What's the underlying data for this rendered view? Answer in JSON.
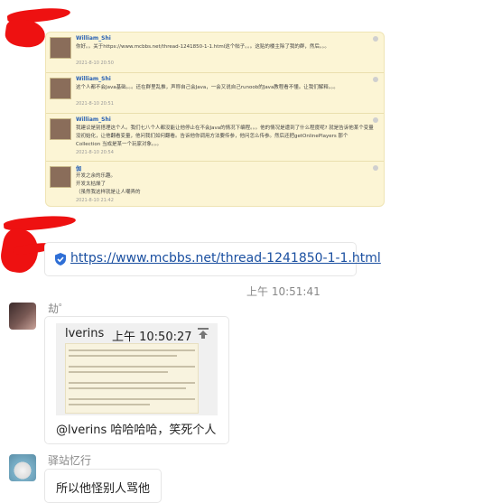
{
  "forum": {
    "posts": [
      {
        "author": "William_Shi",
        "text": "你好。。关于https://www.mcbbs.net/thread-1241850-1-1.html这个帖子。。。这贴的楼主除了我的群，然后。。。",
        "time": "2021-8-10 20:50"
      },
      {
        "author": "William_Shi",
        "text": "这个人都不会Java基础。。。还在群里乱推，声称自己会Java，一会又说自己runoob的Java教程看不懂。让我们解释。。。",
        "time": "2021-8-10 20:51"
      },
      {
        "author": "William_Shi",
        "text": "我建议是别搭理这个人。我们七八个人都没能让他停止在不会Java的情况下编程。。。他的情况是遭到了什么程度呢? 就是告诉他某个变量没初始化，让他翻看变量，他问我们如何翻看。告诉他你调用方法要传参，他问怎么传参。然后还把getOnlinePlayers 那个 Collection 当成是某一个玩家对象。。。",
        "time": "2021-8-10 20:54"
      },
      {
        "author": "伽",
        "text": "开发之余的乐趣。\n开发太枯燥了\n（虽然我这样就是让人嘲弄的",
        "time": "2021-8-10 21:42"
      }
    ]
  },
  "link_message": {
    "url": "https://www.mcbbs.net/thread-1241850-1-1.html",
    "icon": "shield-check-icon"
  },
  "timestamp": "上午 10:51:41",
  "message1": {
    "sender": "劫゜",
    "quote_author": "lverins",
    "quote_time": "上午 10:50:27",
    "text": "@lverins 哈哈哈哈，笑死个人"
  },
  "message2": {
    "sender": "驿站忆行",
    "text": "所以他怪别人骂他"
  }
}
